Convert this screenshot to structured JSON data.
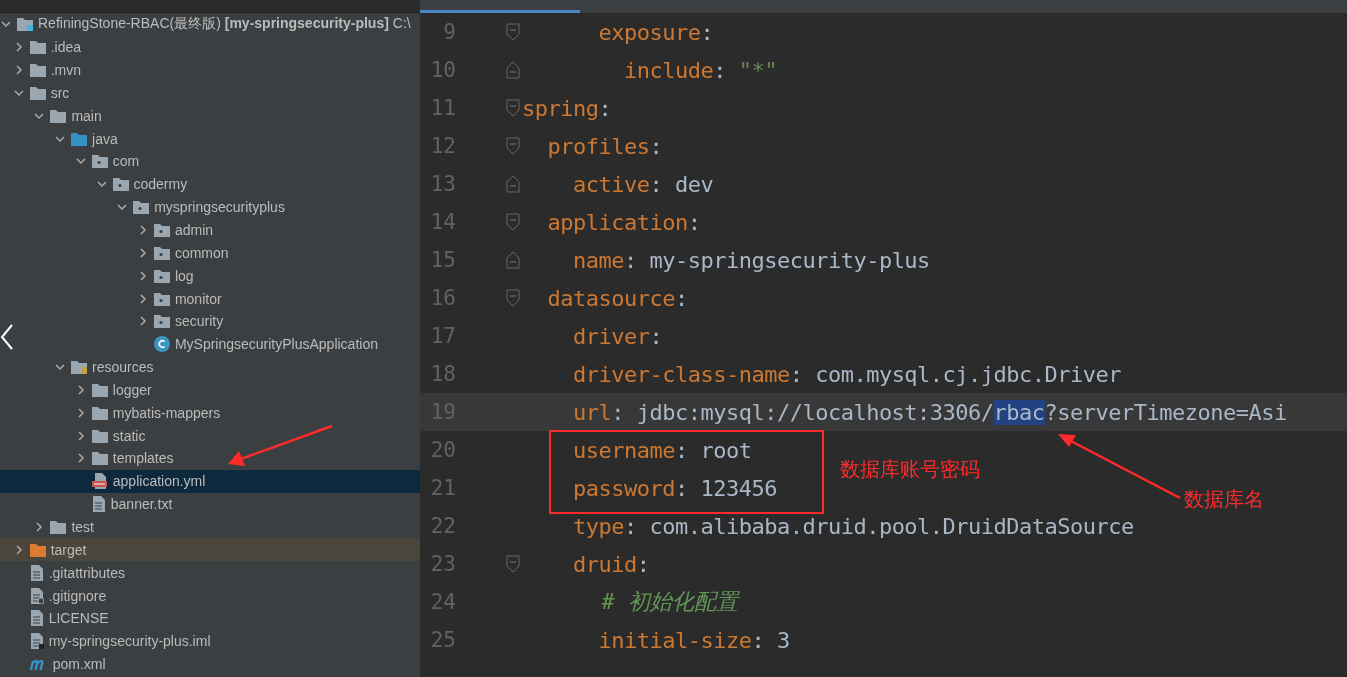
{
  "project_tree": [
    {
      "label": "RefiningStone-RBAC(最终版) **[my-springsecurity-plus]** C:\\",
      "kind": "module",
      "expanded": true,
      "selected": false,
      "children": [
        {
          "label": ".idea",
          "kind": "folder",
          "expanded": false,
          "selected": false
        },
        {
          "label": ".mvn",
          "kind": "folder",
          "expanded": false,
          "selected": false
        },
        {
          "label": "src",
          "kind": "folder",
          "expanded": true,
          "selected": false,
          "children": [
            {
              "label": "main",
              "kind": "folder",
              "expanded": true,
              "selected": false,
              "children": [
                {
                  "label": "java",
                  "kind": "source-folder",
                  "expanded": true,
                  "selected": false,
                  "children": [
                    {
                      "label": "com",
                      "kind": "package",
                      "expanded": true,
                      "selected": false,
                      "children": [
                        {
                          "label": "codermy",
                          "kind": "package",
                          "expanded": true,
                          "selected": false,
                          "children": [
                            {
                              "label": "myspringsecurityplus",
                              "kind": "package",
                              "expanded": true,
                              "selected": false,
                              "children": [
                                {
                                  "label": "admin",
                                  "kind": "package",
                                  "expanded": false,
                                  "selected": false
                                },
                                {
                                  "label": "common",
                                  "kind": "package",
                                  "expanded": false,
                                  "selected": false
                                },
                                {
                                  "label": "log",
                                  "kind": "package",
                                  "expanded": false,
                                  "selected": false
                                },
                                {
                                  "label": "monitor",
                                  "kind": "package",
                                  "expanded": false,
                                  "selected": false
                                },
                                {
                                  "label": "security",
                                  "kind": "package",
                                  "expanded": false,
                                  "selected": false
                                },
                                {
                                  "label": "MySpringsecurityPlusApplication",
                                  "kind": "class",
                                  "selected": false
                                }
                              ]
                            }
                          ]
                        }
                      ]
                    }
                  ]
                },
                {
                  "label": "resources",
                  "kind": "resource-folder",
                  "expanded": true,
                  "selected": false,
                  "children": [
                    {
                      "label": "logger",
                      "kind": "folder",
                      "expanded": false,
                      "selected": false
                    },
                    {
                      "label": "mybatis-mappers",
                      "kind": "folder",
                      "expanded": false,
                      "selected": false
                    },
                    {
                      "label": "static",
                      "kind": "folder",
                      "expanded": false,
                      "selected": false
                    },
                    {
                      "label": "templates",
                      "kind": "folder",
                      "expanded": false,
                      "selected": false
                    },
                    {
                      "label": "application.yml",
                      "kind": "yml",
                      "selected": true
                    },
                    {
                      "label": "banner.txt",
                      "kind": "text-file",
                      "selected": false
                    }
                  ]
                }
              ]
            },
            {
              "label": "test",
              "kind": "folder",
              "expanded": false,
              "selected": false
            }
          ]
        },
        {
          "label": "target",
          "kind": "excluded-folder",
          "expanded": false,
          "selected": false
        },
        {
          "label": ".gitattributes",
          "kind": "text-file",
          "selected": false
        },
        {
          "label": ".gitignore",
          "kind": "ignore-file",
          "selected": false
        },
        {
          "label": "LICENSE",
          "kind": "text-file",
          "selected": false
        },
        {
          "label": "my-springsecurity-plus.iml",
          "kind": "module-file",
          "selected": false
        },
        {
          "label": "pom.xml",
          "kind": "maven",
          "selected": false
        }
      ]
    }
  ],
  "editor": {
    "lines": [
      {
        "number": "9",
        "kind": "pair",
        "fold": {
          "kind": "start"
        },
        "current": false,
        "key": "      exposure",
        "sep": ":"
      },
      {
        "number": "10",
        "kind": "pair",
        "fold": {
          "kind": "end"
        },
        "current": false,
        "key": "        include",
        "sep": ":",
        "value": [
          {
            "text": "\"*\"",
            "kind": "string",
            "selected": false
          }
        ]
      },
      {
        "number": "11",
        "kind": "pair",
        "fold": {
          "kind": "start"
        },
        "current": false,
        "key": "spring",
        "sep": ":"
      },
      {
        "number": "12",
        "kind": "pair",
        "fold": {
          "kind": "start"
        },
        "current": false,
        "key": "  profiles",
        "sep": ":"
      },
      {
        "number": "13",
        "kind": "pair",
        "fold": {
          "kind": "end"
        },
        "current": false,
        "key": "    active",
        "sep": ":",
        "value": [
          {
            "text": "dev",
            "kind": "plain",
            "selected": false
          }
        ]
      },
      {
        "number": "14",
        "kind": "pair",
        "fold": {
          "kind": "start"
        },
        "current": false,
        "key": "  application",
        "sep": ":"
      },
      {
        "number": "15",
        "kind": "pair",
        "fold": {
          "kind": "end"
        },
        "current": false,
        "key": "    name",
        "sep": ":",
        "value": [
          {
            "text": "my-springsecurity-plus",
            "kind": "plain",
            "selected": false
          }
        ]
      },
      {
        "number": "16",
        "kind": "pair",
        "fold": {
          "kind": "start"
        },
        "current": false,
        "key": "  datasource",
        "sep": ":"
      },
      {
        "number": "17",
        "kind": "pair",
        "current": false,
        "key": "    driver",
        "sep": ":"
      },
      {
        "number": "18",
        "kind": "pair",
        "current": false,
        "key": "    driver-class-name",
        "sep": ":",
        "value": [
          {
            "text": "com.mysql.cj.jdbc.Driver",
            "kind": "plain",
            "selected": false
          }
        ]
      },
      {
        "number": "19",
        "kind": "pair",
        "current": true,
        "key": "    url",
        "sep": ":",
        "value": [
          {
            "text": "jdbc:mysql://localhost:3306/",
            "kind": "plain",
            "selected": false
          },
          {
            "text": "rbac",
            "kind": "plain",
            "selected": true
          },
          {
            "text": "?serverTimezone=Asi",
            "kind": "plain",
            "selected": false
          }
        ]
      },
      {
        "number": "20",
        "kind": "pair",
        "current": false,
        "key": "    username",
        "sep": ":",
        "value": [
          {
            "text": "root",
            "kind": "plain",
            "selected": false
          }
        ]
      },
      {
        "number": "21",
        "kind": "pair",
        "current": false,
        "key": "    password",
        "sep": ":",
        "value": [
          {
            "text": "123456",
            "kind": "plain",
            "selected": false
          }
        ]
      },
      {
        "number": "22",
        "kind": "pair",
        "current": false,
        "key": "    type",
        "sep": ":",
        "value": [
          {
            "text": "com.alibaba.druid.pool.DruidDataSource",
            "kind": "plain",
            "selected": false
          }
        ]
      },
      {
        "number": "23",
        "kind": "pair",
        "fold": {
          "kind": "start"
        },
        "current": false,
        "key": "    druid",
        "sep": ":"
      },
      {
        "number": "24",
        "kind": "comment",
        "current": false,
        "key": "      # 初始化配置"
      },
      {
        "number": "25",
        "kind": "pair",
        "current": false,
        "key": "      initial-size",
        "sep": ":",
        "value": [
          {
            "text": "3",
            "kind": "plain",
            "selected": false
          }
        ]
      }
    ]
  },
  "annotations": [
    {
      "kind": "box-note",
      "text": "数据库账号密码"
    },
    {
      "kind": "arrow-note",
      "text": "数据库名"
    },
    {
      "kind": "arrow"
    }
  ]
}
